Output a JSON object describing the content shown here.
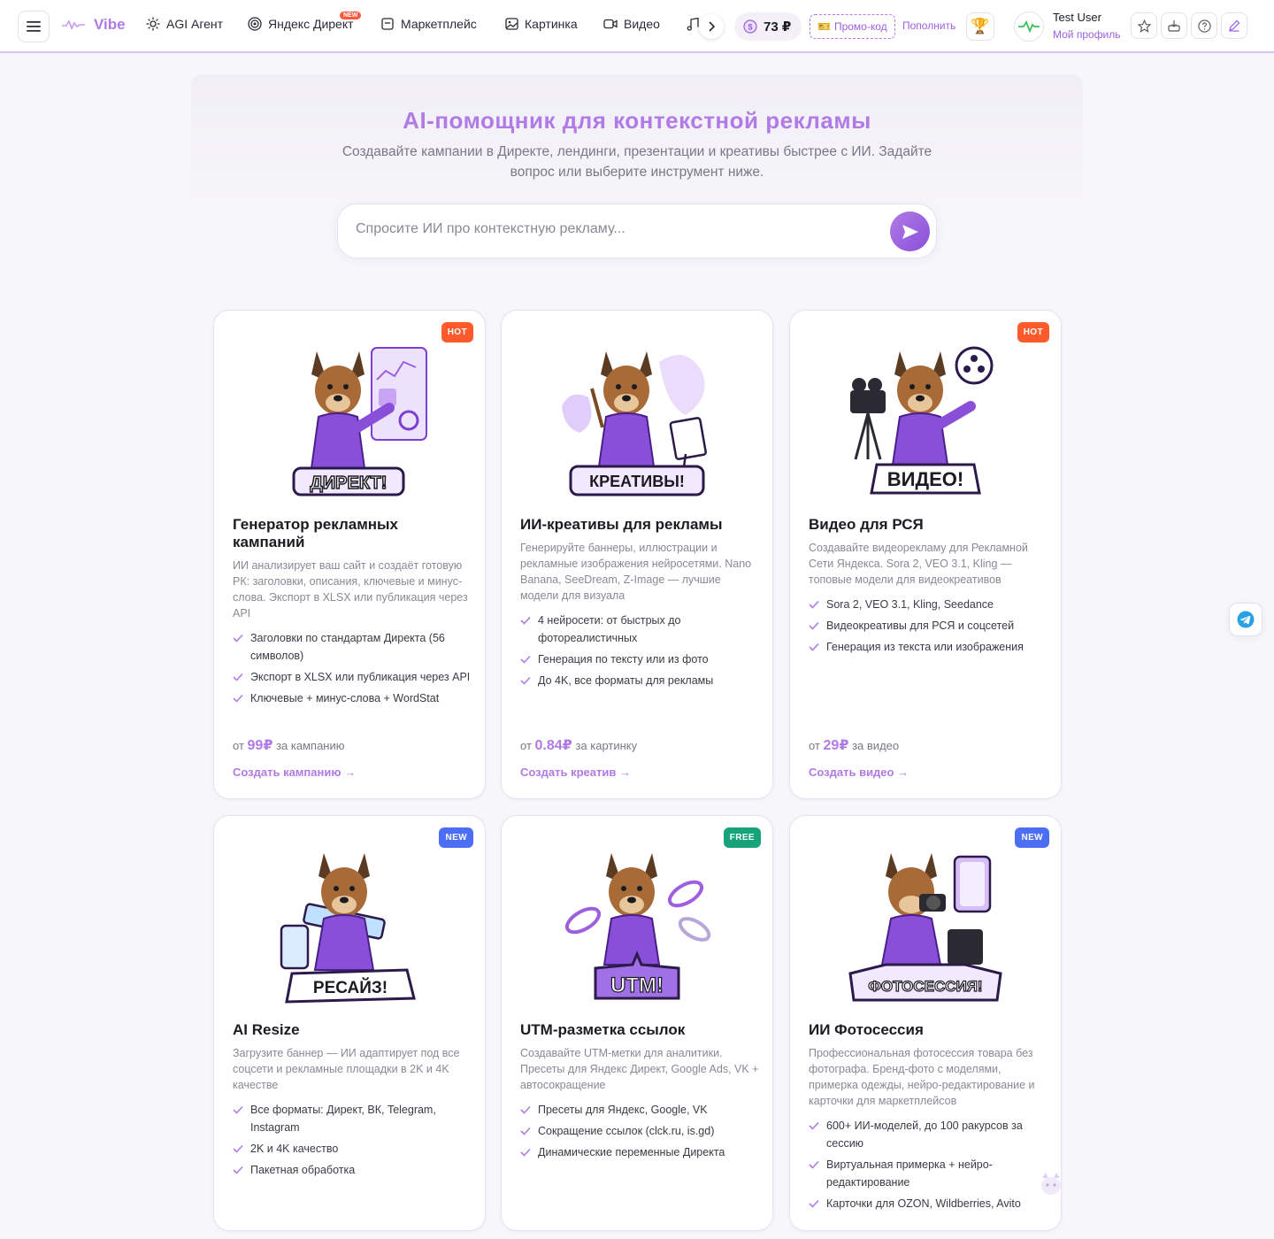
{
  "header": {
    "brand": "Vibe",
    "nav": [
      {
        "label": "AGI Агент",
        "icon": "sparkle-icon"
      },
      {
        "label": "Яндекс Директ",
        "icon": "target-icon",
        "tag": "NEW"
      },
      {
        "label": "Маркетплейс",
        "icon": "box-icon"
      },
      {
        "label": "Картинка",
        "icon": "image-icon"
      },
      {
        "label": "Видео",
        "icon": "video-icon"
      }
    ],
    "balance": "73 ₽",
    "promo": "Промо-код",
    "topup": "Пополнить",
    "user_name": "Test User",
    "user_profile": "Мой профиль"
  },
  "hero": {
    "title": "AI-помощник для контекстной рекламы",
    "subtitle": "Создавайте кампании в Директе, лендинги, презентации и креативы быстрее с ИИ. Задайте вопрос или выберите инструмент ниже.",
    "placeholder": "Спросите ИИ про контекстную рекламу..."
  },
  "cards": [
    {
      "badge": "HOT",
      "sticker": "ДИРЕКТ!",
      "title": "Генератор рекламных кампаний",
      "desc": "ИИ анализирует ваш сайт и создаёт готовую РК: заголовки, описания, ключевые и минус-слова. Экспорт в XLSX или публикация через API",
      "features": [
        "Заголовки по стандартам Директа (56 символов)",
        "Экспорт в XLSX или публикация через API",
        "Ключевые + минус-слова + WordStat"
      ],
      "price_prefix": "от",
      "price": "99₽",
      "price_suffix": "за кампанию",
      "cta": "Создать кампанию →"
    },
    {
      "badge": "",
      "sticker": "КРЕАТИВЫ!",
      "title": "ИИ-креативы для рекламы",
      "desc": "Генерируйте баннеры, иллюстрации и рекламные изображения нейросетями. Nano Banana, SeeDream, Z-Image — лучшие модели для визуала",
      "features": [
        "4 нейросети: от быстрых до фотореалистичных",
        "Генерация по тексту или из фото",
        "До 4K, все форматы для рекламы"
      ],
      "price_prefix": "от",
      "price": "0.84₽",
      "price_suffix": "за картинку",
      "cta": "Создать креатив →"
    },
    {
      "badge": "HOT",
      "sticker": "ВИДЕО!",
      "title": "Видео для РСЯ",
      "desc": "Создавайте видеорекламу для Рекламной Сети Яндекса. Sora 2, VEO 3.1, Kling — топовые модели для видеокреативов",
      "features": [
        "Sora 2, VEO 3.1, Kling, Seedance",
        "Видеокреативы для РСЯ и соцсетей",
        "Генерация из текста или изображения"
      ],
      "price_prefix": "от",
      "price": "29₽",
      "price_suffix": "за видео",
      "cta": "Создать видео →"
    },
    {
      "badge": "NEW",
      "sticker": "РЕСАЙЗ!",
      "title": "AI Resize",
      "desc": "Загрузите баннер — ИИ адаптирует под все соцсети и рекламные площадки в 2K и 4K качестве",
      "features": [
        "Все форматы: Директ, ВК, Telegram, Instagram",
        "2K и 4K качество",
        "Пакетная обработка"
      ]
    },
    {
      "badge": "FREE",
      "sticker": "UTM!",
      "title": "UTM-разметка ссылок",
      "desc": "Создавайте UTM-метки для аналитики. Пресеты для Яндекс Директ, Google Ads, VK + автосокращение",
      "features": [
        "Пресеты для Яндекс, Google, VK",
        "Сокращение ссылок (clck.ru, is.gd)",
        "Динамические переменные Директа"
      ]
    },
    {
      "badge": "NEW",
      "sticker": "ФОТОСЕССИЯ!",
      "title": "ИИ Фотосессия",
      "desc": "Профессиональная фотосессия товара без фотографа. Бренд-фото с моделями, примерка одежды, нейро-редактирование и карточки для маркетплейсов",
      "features": [
        "600+ ИИ-моделей, до 100 ракурсов за сессию",
        "Виртуальная примерка + нейро-редактирование",
        "Карточки для OZON, Wildberries, Avito"
      ]
    }
  ]
}
